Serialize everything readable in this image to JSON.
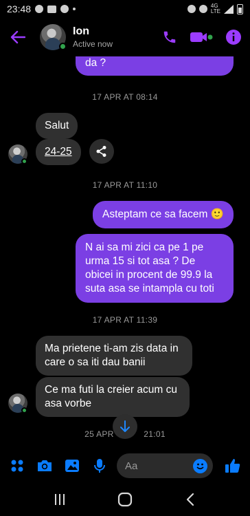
{
  "status_bar": {
    "time": "23:48",
    "network": "4G",
    "network_sub": "LTE"
  },
  "header": {
    "contact_name": "Ion",
    "contact_status": "Active now",
    "accent_color": "#9b3cff"
  },
  "messages": {
    "partial_out": "da ?",
    "ts1": "17 APR AT 08:14",
    "in1": "Salut",
    "in2_link": "24-25",
    "ts2": "17 APR AT 11:10",
    "out1": "Asteptam ce sa facem 🙂",
    "out2": "N ai sa mi zici ca pe 1 pe urma 15 si tot asa ? De obicei in procent de 99.9 la suta asa se intampla cu toti",
    "ts3": "17 APR AT 11:39",
    "in3": "Ma prietene ti-am zis data in care o sa iti dau banii",
    "in4": "Ce ma futi la creier acum cu asa vorbe",
    "ts4_left": "25 APR",
    "ts4_right": "21:01"
  },
  "composer": {
    "placeholder": "Aa"
  },
  "colors": {
    "outgoing_bubble": "#7b3fe4",
    "incoming_bubble": "#303030",
    "messenger_blue": "#0a7cff"
  },
  "icons": [
    "back-arrow-icon",
    "phone-icon",
    "video-camera-icon",
    "info-icon",
    "share-icon",
    "chevron-down-icon",
    "apps-icon",
    "camera-icon",
    "gallery-icon",
    "microphone-icon",
    "emoji-icon",
    "thumbs-up-icon",
    "recent-apps-icon",
    "home-icon",
    "back-icon"
  ]
}
